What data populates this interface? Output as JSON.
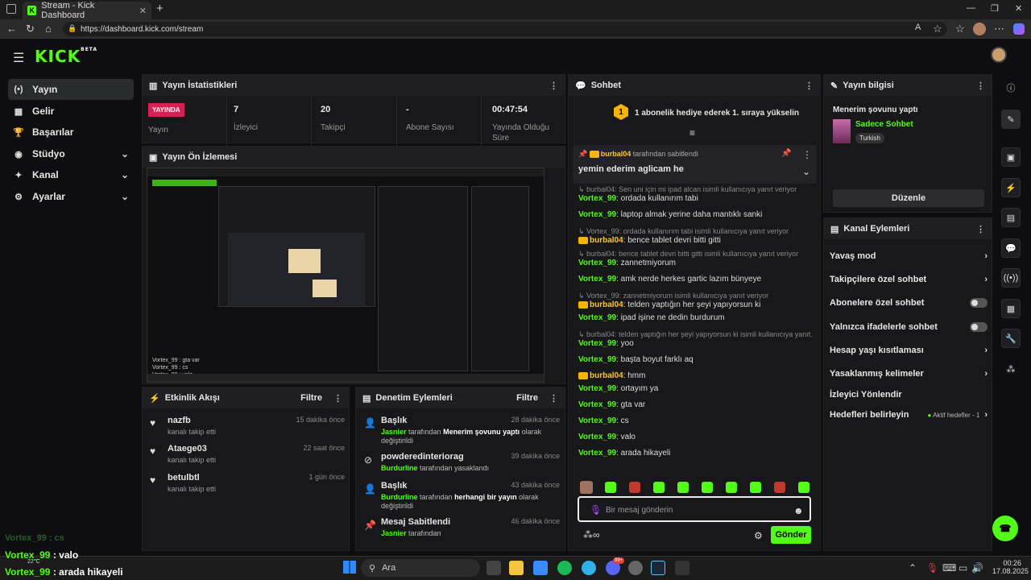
{
  "browser": {
    "tab_title": "Stream - Kick Dashboard",
    "url": "https://dashboard.kick.com/stream"
  },
  "header": {
    "logo": "KICK",
    "beta": "BETA"
  },
  "sidebar": {
    "items": [
      {
        "label": "Yayın",
        "icon": "broadcast-icon"
      },
      {
        "label": "Gelir",
        "icon": "revenue-icon"
      },
      {
        "label": "Başarılar",
        "icon": "trophy-icon"
      },
      {
        "label": "Stüdyo",
        "icon": "studio-icon"
      },
      {
        "label": "Kanal",
        "icon": "channel-icon"
      },
      {
        "label": "Ayarlar",
        "icon": "gear-icon"
      }
    ]
  },
  "stats": {
    "title": "Yayın İstatistikleri",
    "live_badge": "YAYINDA",
    "live_label": "Yayın",
    "viewers": "7",
    "viewers_label": "İzleyici",
    "followers": "20",
    "followers_label": "Takipçi",
    "subs": "-",
    "subs_label": "Abone Sayısı",
    "duration": "00:47:54",
    "duration_label": "Yayında Olduğu Süre"
  },
  "preview": {
    "title": "Yayın Ön İzlemesi"
  },
  "activity": {
    "title": "Etkinlik Akışı",
    "filter": "Filtre",
    "items": [
      {
        "name": "nazfb",
        "sub": "kanalı takip etti",
        "time": "15 dakika önce"
      },
      {
        "name": "Ataege03",
        "sub": "kanalı takip etti",
        "time": "22 saat önce"
      },
      {
        "name": "betulbtl",
        "sub": "kanalı takip etti",
        "time": "1 gün önce"
      }
    ]
  },
  "moderation": {
    "title": "Denetim Eylemleri",
    "filter": "Filtre",
    "items": [
      {
        "title": "Başlık",
        "time": "28 dakika önce",
        "user": "Jasnier",
        "mid": " tarafından ",
        "bold": "Menerim şovunu yaptı",
        "tail": " olarak değiştirildi"
      },
      {
        "title": "powderedinteriorag",
        "time": "39 dakika önce",
        "user": "Burdurline",
        "mid": " tarafından yasaklandı",
        "bold": "",
        "tail": ""
      },
      {
        "title": "Başlık",
        "time": "43 dakika önce",
        "user": "Burdurline",
        "mid": " tarafından ",
        "bold": "herhangi bir yayın",
        "tail": " olarak değiştirildi"
      },
      {
        "title": "Mesaj Sabitlendi",
        "time": "46 dakika önce",
        "user": "Jasnier",
        "mid": " tarafından",
        "bold": "",
        "tail": ""
      }
    ]
  },
  "chat": {
    "title": "Sohbet",
    "gift_rank": "1",
    "gift_text": "1 abonelik hediye ederek 1. sıraya yükselin",
    "pinned_by": "burbal04",
    "pinned_suffix": "tarafından sabitlendi",
    "pinned_msg": "yemin ederim aglicam he",
    "placeholder": "Bir mesaj gönderin",
    "send": "Gönder",
    "lines": [
      {
        "type": "reply",
        "text": "burbal04: Sen uni için mi ipad alcan isimli kullanıcıya yanıt veriyor"
      },
      {
        "type": "msg",
        "user": "Vortex_99",
        "text": "ordada kullanırım tabi"
      },
      {
        "type": "msg",
        "user": "Vortex_99",
        "text": "laptop almak yerine daha mantıklı sanki"
      },
      {
        "type": "reply",
        "text": "Vortex_99: ordada kullanırım tabi isimli kullanıcıya yanıt veriyor"
      },
      {
        "type": "msgy",
        "user": "burbal04",
        "text": "bence tablet devri bitti gitti"
      },
      {
        "type": "reply",
        "text": "burbal04: bence tablet devri bitti gitti isimli kullanıcıya yanıt veriyor"
      },
      {
        "type": "msg",
        "user": "Vortex_99",
        "text": "zannetmiyorum"
      },
      {
        "type": "msg",
        "user": "Vortex_99",
        "text": "amk nerde herkes gartic lazım bünyeye"
      },
      {
        "type": "reply",
        "text": "Vortex_99: zannetmiyorum isimli kullanıcıya yanıt veriyor"
      },
      {
        "type": "msgy",
        "user": "burbal04",
        "text": "telden yaptığın her şeyi yapıyorsun ki"
      },
      {
        "type": "msg",
        "user": "Vortex_99",
        "text": "ipad işine ne dedin burdurum"
      },
      {
        "type": "reply",
        "text": "burbal04: telden yaptığın her şeyi yapıyorsun ki isimli kullanıcıya yanıt..."
      },
      {
        "type": "msg",
        "user": "Vortex_99",
        "text": "yoo"
      },
      {
        "type": "msg",
        "user": "Vortex_99",
        "text": "başta boyut farklı aq"
      },
      {
        "type": "msgy",
        "user": "burbal04",
        "text": "hmm"
      },
      {
        "type": "msg",
        "user": "Vortex_99",
        "text": "ortayım ya"
      },
      {
        "type": "msg",
        "user": "Vortex_99",
        "text": "gta var"
      },
      {
        "type": "msg",
        "user": "Vortex_99",
        "text": "cs"
      },
      {
        "type": "msg",
        "user": "Vortex_99",
        "text": "valo"
      },
      {
        "type": "msg",
        "user": "Vortex_99",
        "text": "arada hikayeli"
      }
    ]
  },
  "stream_info": {
    "title": "Yayın bilgisi",
    "stream_title": "Menerim şovunu yaptı",
    "category": "Sadece Sohbet",
    "language": "Turkish",
    "edit": "Düzenle"
  },
  "channel_actions": {
    "title": "Kanal Eylemleri",
    "items": [
      {
        "label": "Yavaş mod",
        "ctrl": "arrow"
      },
      {
        "label": "Takipçilere özel sohbet",
        "ctrl": "arrow"
      },
      {
        "label": "Abonelere özel sohbet",
        "ctrl": "toggle"
      },
      {
        "label": "Yalnızca ifadelerle sohbet",
        "ctrl": "toggle"
      },
      {
        "label": "Hesap yaşı kısıtlaması",
        "ctrl": "arrow"
      },
      {
        "label": "Yasaklanmış kelimeler",
        "ctrl": "arrow"
      },
      {
        "label": "İzleyici Yönlendir",
        "ctrl": "none"
      },
      {
        "label": "Hedefleri belirleyin",
        "ctrl": "goal"
      }
    ],
    "goal_status": "Aktif hedefler - 1"
  },
  "overlay": {
    "line1": "Vortex_99 : cs",
    "line2_user": "Vortex_99",
    "line2_text": " : valo",
    "line3_user": "Vortex_99",
    "line3_text": " : arada hikayeli",
    "temp": "22°C"
  },
  "taskbar": {
    "search": "Ara",
    "time": "00:26",
    "date": "17.08.2025",
    "badge": "99+"
  },
  "colors": {
    "accent": "#53fc18",
    "live": "#d72054",
    "bg": "#0e0e10",
    "panel": "#18181b"
  }
}
